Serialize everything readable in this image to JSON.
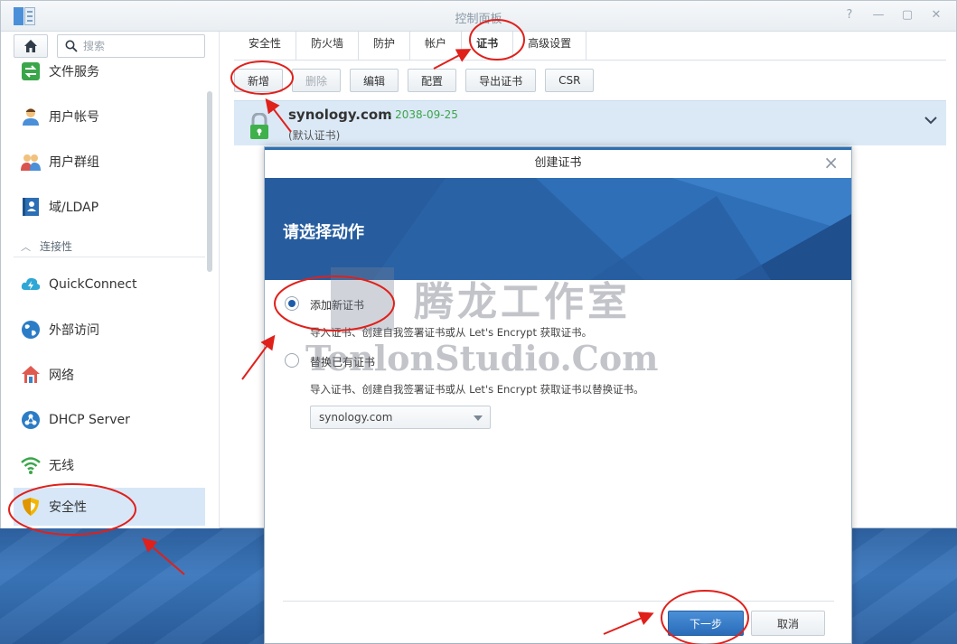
{
  "window": {
    "title": "控制面板",
    "controls": [
      "?",
      "—",
      "▢",
      "✕"
    ]
  },
  "sidebar": {
    "search_placeholder": "搜索",
    "items": [
      {
        "label": "文件服务",
        "icon": "file-services-icon"
      },
      {
        "label": "用户帐号",
        "icon": "user-icon"
      },
      {
        "label": "用户群组",
        "icon": "user-group-icon"
      },
      {
        "label": "域/LDAP",
        "icon": "domain-ldap-icon"
      }
    ],
    "section": "连接性",
    "section_items": [
      {
        "label": "QuickConnect",
        "icon": "quickconnect-icon"
      },
      {
        "label": "外部访问",
        "icon": "globe-icon"
      },
      {
        "label": "网络",
        "icon": "network-house-icon"
      },
      {
        "label": "DHCP Server",
        "icon": "dhcp-icon"
      },
      {
        "label": "无线",
        "icon": "wifi-icon"
      },
      {
        "label": "安全性",
        "icon": "shield-icon",
        "active": true
      }
    ]
  },
  "tabs": [
    {
      "label": "安全性"
    },
    {
      "label": "防火墙"
    },
    {
      "label": "防护"
    },
    {
      "label": "帐户"
    },
    {
      "label": "证书",
      "active": true
    },
    {
      "label": "高级设置"
    }
  ],
  "toolbar": {
    "add": "新增",
    "delete": "删除",
    "edit": "编辑",
    "configure": "配置",
    "export": "导出证书",
    "csr": "CSR"
  },
  "certificate": {
    "name": "synology.com",
    "date": "- 2038-09-25",
    "subtitle": "(默认证书)"
  },
  "modal": {
    "title": "创建证书",
    "banner_title": "请选择动作",
    "option1_label": "添加新证书",
    "option1_desc": "导入证书、创建自我签署证书或从 Let's Encrypt 获取证书。",
    "option2_label": "替换已有证书",
    "option2_desc": "导入证书、创建自我签署证书或从 Let's Encrypt 获取证书以替换证书。",
    "select_value": "synology.com",
    "next": "下一步",
    "cancel": "取消"
  },
  "watermark": {
    "cn": "腾龙工作室",
    "en": "TenlonStudio.Com"
  },
  "colors": {
    "accent": "#2a6cb8",
    "active_row": "#dbe9f7",
    "annotation": "#e0201b",
    "green_date": "#3ea34a"
  }
}
